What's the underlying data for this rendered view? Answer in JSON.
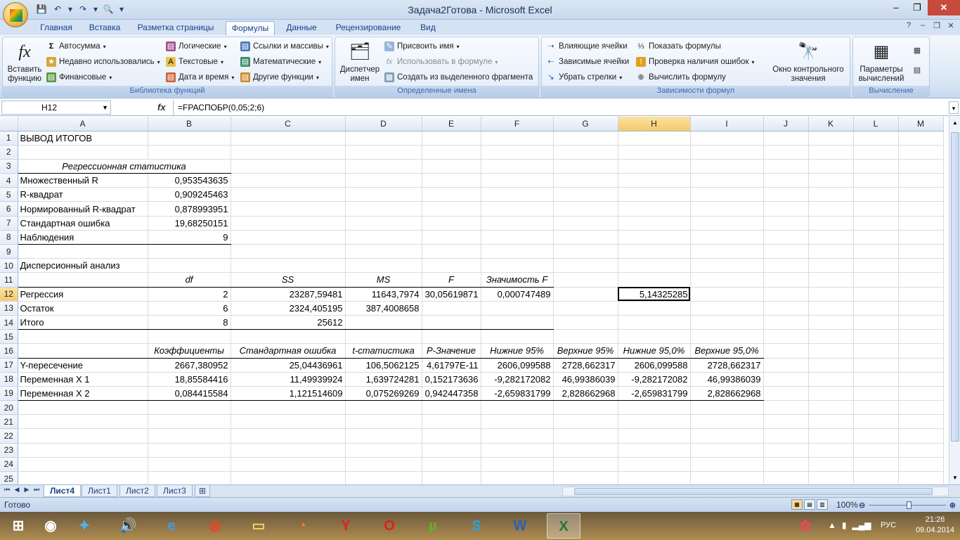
{
  "window": {
    "title": "Задача2Готова - Microsoft Excel"
  },
  "ribbon_tabs": [
    "Главная",
    "Вставка",
    "Разметка страницы",
    "Формулы",
    "Данные",
    "Рецензирование",
    "Вид"
  ],
  "ribbon": {
    "insert_function": "Вставить функцию",
    "library": {
      "autosum": "Автосумма",
      "recent": "Недавно использовались",
      "financial": "Финансовые",
      "logical": "Логические",
      "text": "Текстовые",
      "datetime": "Дата и время",
      "lookup": "Ссылки и массивы",
      "math": "Математические",
      "other": "Другие функции",
      "label": "Библиотека функций"
    },
    "names": {
      "manager": "Диспетчер имен",
      "define": "Присвоить имя",
      "use_in_formula": "Использовать в формуле",
      "create_from_selection": "Создать из выделенного фрагмента",
      "label": "Определенные имена"
    },
    "audit": {
      "trace_precedents": "Влияющие ячейки",
      "trace_dependents": "Зависимые ячейки",
      "remove_arrows": "Убрать стрелки",
      "show_formulas": "Показать формулы",
      "error_checking": "Проверка наличия ошибок",
      "evaluate": "Вычислить формулу",
      "watch_window": "Окно контрольного значения",
      "label": "Зависимости формул"
    },
    "calc": {
      "options": "Параметры вычислений",
      "label": "Вычисление"
    }
  },
  "formula_bar": {
    "name_box": "H12",
    "fx": "fx",
    "formula": "=FРАСПОБР(0,05;2;6)"
  },
  "columns": [
    "A",
    "B",
    "C",
    "D",
    "E",
    "F",
    "G",
    "H",
    "I",
    "J",
    "K",
    "L",
    "M"
  ],
  "selected": {
    "col": "H",
    "row": 12
  },
  "rows": [
    {
      "n": 1,
      "cells": {
        "A": "ВЫВОД ИТОГОВ"
      }
    },
    {
      "n": 2,
      "cells": {}
    },
    {
      "n": 3,
      "cells": {
        "A": "Регрессионная статистика"
      }
    },
    {
      "n": 4,
      "cells": {
        "A": "Множественный R",
        "B": "0,953543635"
      }
    },
    {
      "n": 5,
      "cells": {
        "A": "R-квадрат",
        "B": "0,909245463"
      }
    },
    {
      "n": 6,
      "cells": {
        "A": "Нормированный R-квадрат",
        "B": "0,878993951"
      }
    },
    {
      "n": 7,
      "cells": {
        "A": "Стандартная ошибка",
        "B": "19,68250151"
      }
    },
    {
      "n": 8,
      "cells": {
        "A": "Наблюдения",
        "B": "9"
      }
    },
    {
      "n": 9,
      "cells": {}
    },
    {
      "n": 10,
      "cells": {
        "A": "Дисперсионный анализ"
      }
    },
    {
      "n": 11,
      "cells": {
        "B": "df",
        "C": "SS",
        "D": "MS",
        "E": "F",
        "F": "Значимость F"
      }
    },
    {
      "n": 12,
      "cells": {
        "A": "Регрессия",
        "B": "2",
        "C": "23287,59481",
        "D": "11643,7974",
        "E": "30,05619871",
        "F": "0,000747489",
        "H": "5,14325285"
      }
    },
    {
      "n": 13,
      "cells": {
        "A": "Остаток",
        "B": "6",
        "C": "2324,405195",
        "D": "387,4008658"
      }
    },
    {
      "n": 14,
      "cells": {
        "A": "Итого",
        "B": "8",
        "C": "25612"
      }
    },
    {
      "n": 15,
      "cells": {}
    },
    {
      "n": 16,
      "cells": {
        "B": "Коэффициенты",
        "C": "Стандартная ошибка",
        "D": "t-статистика",
        "E": "P-Значение",
        "F": "Нижние 95%",
        "G": "Верхние 95%",
        "H": "Нижние 95,0%",
        "I": "Верхние 95,0%"
      }
    },
    {
      "n": 17,
      "cells": {
        "A": "Y-пересечение",
        "B": "2667,380952",
        "C": "25,04436961",
        "D": "106,5062125",
        "E": "4,61797E-11",
        "F": "2606,099588",
        "G": "2728,662317",
        "H": "2606,099588",
        "I": "2728,662317"
      }
    },
    {
      "n": 18,
      "cells": {
        "A": "Переменная X 1",
        "B": "18,85584416",
        "C": "11,49939924",
        "D": "1,639724281",
        "E": "0,152173636",
        "F": "-9,282172082",
        "G": "46,99386039",
        "H": "-9,282172082",
        "I": "46,99386039"
      }
    },
    {
      "n": 19,
      "cells": {
        "A": "Переменная X 2",
        "B": "0,084415584",
        "C": "1,121514609",
        "D": "0,075269269",
        "E": "0,942447358",
        "F": "-2,659831799",
        "G": "2,828662968",
        "H": "-2,659831799",
        "I": "2,828662968"
      }
    },
    {
      "n": 20,
      "cells": {}
    },
    {
      "n": 21,
      "cells": {}
    },
    {
      "n": 22,
      "cells": {}
    },
    {
      "n": 23,
      "cells": {}
    },
    {
      "n": 24,
      "cells": {}
    },
    {
      "n": 25,
      "cells": {}
    }
  ],
  "sheets": [
    "Лист4",
    "Лист1",
    "Лист2",
    "Лист3"
  ],
  "active_sheet": "Лист4",
  "status": {
    "ready": "Готово",
    "zoom": "100%"
  },
  "taskbar": {
    "lang": "РУС",
    "time": "21:26",
    "date": "09.04.2014"
  }
}
